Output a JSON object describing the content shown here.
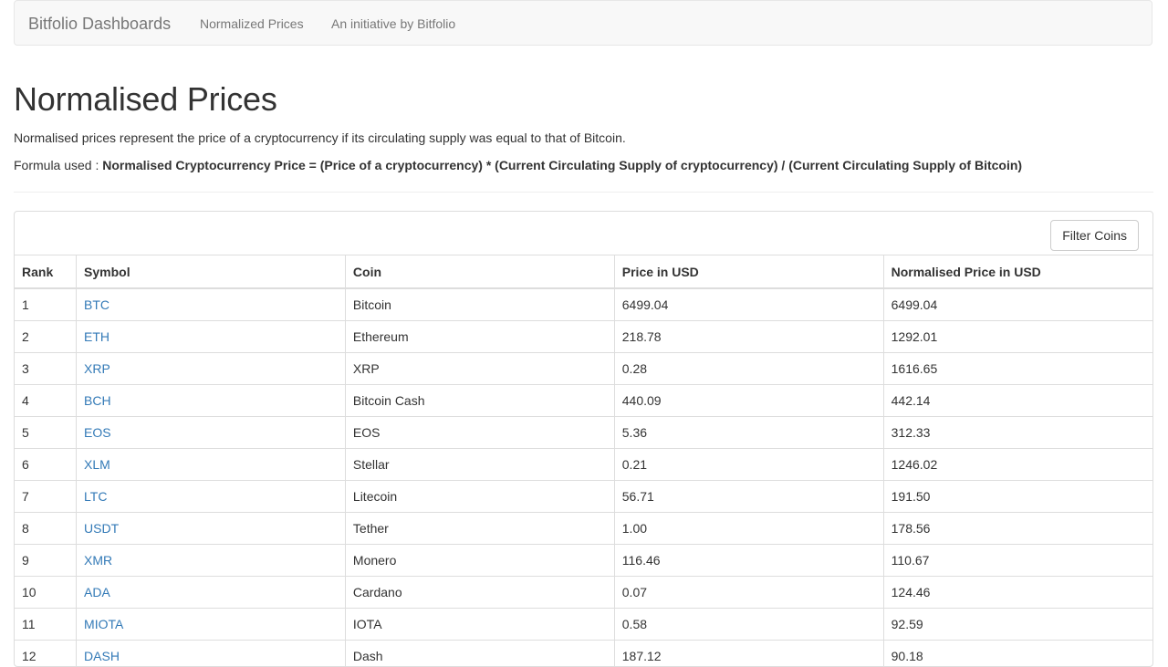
{
  "navbar": {
    "brand": "Bitfolio Dashboards",
    "links": [
      "Normalized Prices",
      "An initiative by Bitfolio"
    ]
  },
  "page": {
    "title": "Normalised Prices",
    "description": "Normalised prices represent the price of a cryptocurrency if its circulating supply was equal to that of Bitcoin.",
    "formula_prefix": "Formula used : ",
    "formula": "Normalised Cryptocurrency Price = (Price of a cryptocurrency) * (Current Circulating Supply of cryptocurrency) / (Current Circulating Supply of Bitcoin)"
  },
  "toolbar": {
    "filter_label": "Filter Coins"
  },
  "table": {
    "columns": [
      "Rank",
      "Symbol",
      "Coin",
      "Price in USD",
      "Normalised Price in USD"
    ],
    "rows": [
      {
        "rank": "1",
        "symbol": "BTC",
        "coin": "Bitcoin",
        "price": "6499.04",
        "normalised": "6499.04"
      },
      {
        "rank": "2",
        "symbol": "ETH",
        "coin": "Ethereum",
        "price": "218.78",
        "normalised": "1292.01"
      },
      {
        "rank": "3",
        "symbol": "XRP",
        "coin": "XRP",
        "price": "0.28",
        "normalised": "1616.65"
      },
      {
        "rank": "4",
        "symbol": "BCH",
        "coin": "Bitcoin Cash",
        "price": "440.09",
        "normalised": "442.14"
      },
      {
        "rank": "5",
        "symbol": "EOS",
        "coin": "EOS",
        "price": "5.36",
        "normalised": "312.33"
      },
      {
        "rank": "6",
        "symbol": "XLM",
        "coin": "Stellar",
        "price": "0.21",
        "normalised": "1246.02"
      },
      {
        "rank": "7",
        "symbol": "LTC",
        "coin": "Litecoin",
        "price": "56.71",
        "normalised": "191.50"
      },
      {
        "rank": "8",
        "symbol": "USDT",
        "coin": "Tether",
        "price": "1.00",
        "normalised": "178.56"
      },
      {
        "rank": "9",
        "symbol": "XMR",
        "coin": "Monero",
        "price": "116.46",
        "normalised": "110.67"
      },
      {
        "rank": "10",
        "symbol": "ADA",
        "coin": "Cardano",
        "price": "0.07",
        "normalised": "124.46"
      },
      {
        "rank": "11",
        "symbol": "MIOTA",
        "coin": "IOTA",
        "price": "0.58",
        "normalised": "92.59"
      },
      {
        "rank": "12",
        "symbol": "DASH",
        "coin": "Dash",
        "price": "187.12",
        "normalised": "90.18"
      }
    ]
  },
  "colors": {
    "link": "#337ab7",
    "navbar_bg": "#f8f8f8",
    "border": "#dddddd",
    "text": "#333333",
    "muted": "#777777"
  }
}
